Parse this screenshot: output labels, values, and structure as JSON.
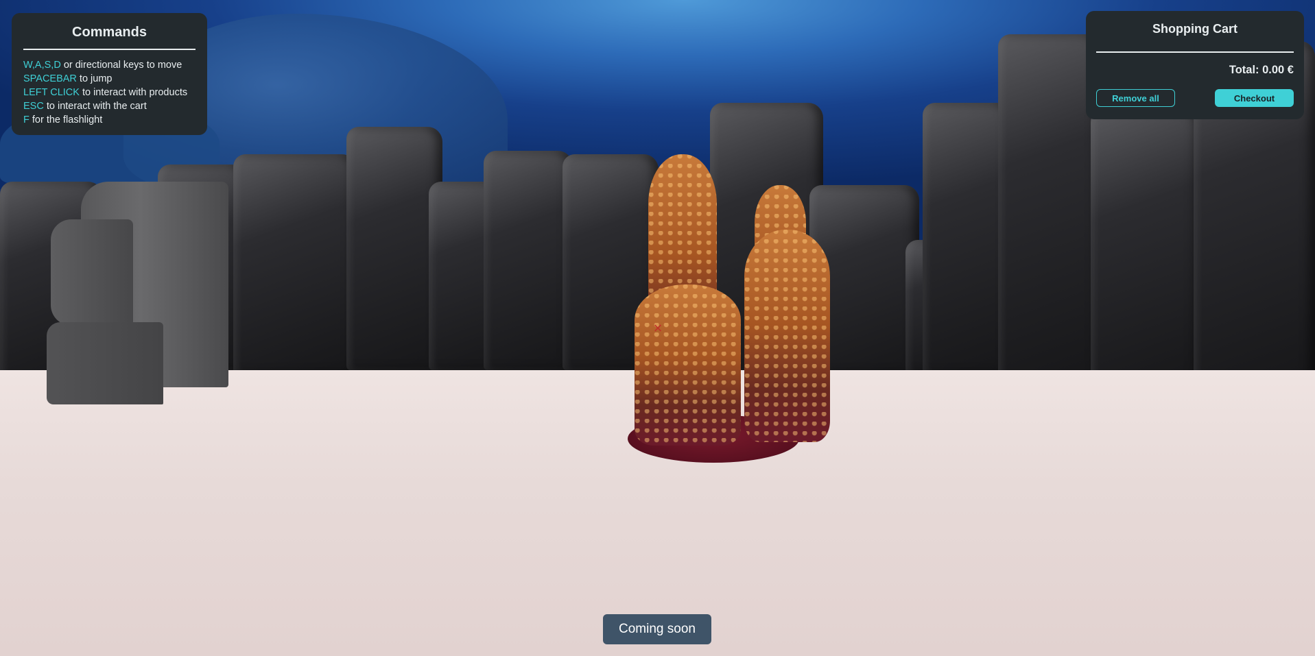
{
  "commands": {
    "title": "Commands",
    "lines": [
      {
        "key": "W,A,S,D",
        "text": " or directional keys to move"
      },
      {
        "key": "SPACEBAR",
        "text": " to jump"
      },
      {
        "key": "LEFT CLICK",
        "text": " to interact with products"
      },
      {
        "key": "ESC",
        "text": " to interact with the cart"
      },
      {
        "key": "F",
        "text": " for the flashlight"
      }
    ]
  },
  "cart": {
    "title": "Shopping Cart",
    "total": "Total: 0.00 €",
    "remove_all_label": "Remove all",
    "checkout_label": "Checkout"
  },
  "toast": {
    "text": "Coming soon"
  },
  "crosshair": {
    "glyph": "×"
  },
  "colors": {
    "accent": "#3fd0d6",
    "panel_bg": "#232a2e",
    "toast_bg": "#3f5468",
    "crosshair": "#c0302a"
  }
}
